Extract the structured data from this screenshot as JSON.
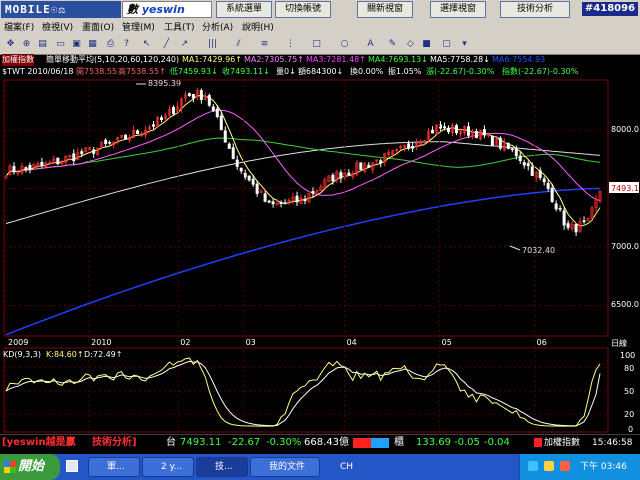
{
  "top": {
    "logo": "MOBILE☉⚖",
    "brand_prefix": "數",
    "brand": "yeswin",
    "buttons": [
      "系統選單",
      "切換帳號",
      "關新視窗",
      "選擇視窗",
      "技術分析"
    ],
    "badge": "#418096"
  },
  "menu": [
    "檔案(F)",
    "檢視(V)",
    "畫面(O)",
    "管理(M)",
    "工具(T)",
    "分析(A)",
    "說明(H)"
  ],
  "title_row": {
    "index_name": "加權指數",
    "ma_label": "簡單移動平均(5,10,20,60,120,240)",
    "ma1": "MA1:7429.96↑",
    "ma2": "MA2:7305.75↑",
    "ma3": "MA3:7281.48↑",
    "ma4": "MA4:7693.13↓",
    "ma5": "MA5:7758.28↓",
    "ma6": "MA6:7554.93"
  },
  "info_row": {
    "symbol_date": "$TWT 2010/06/18",
    "open": "開7538.55",
    "high": "高7538.55↑",
    "low": "低7459.93↓",
    "close": "收7493.11↓",
    "volume": "量0↓",
    "amount": "額684300↓",
    "turnover": "換0.00%",
    "amplitude": "振1.05%",
    "change": "漲(-22.67)-0.30%",
    "pts": "指數(-22.67)-0.30%"
  },
  "price_axis": [
    "8000.0",
    "7500.0",
    "7000.0",
    "6500.0"
  ],
  "price_current": "7493.1",
  "price_unit": "日線",
  "annot_high": "8395.39",
  "annot_low": "7032.40",
  "time_labels": [
    "2009",
    "2010",
    "02",
    "03",
    "04",
    "05",
    "06"
  ],
  "kd": {
    "label": "KD(9,3,3)",
    "k": "K:84.60↑",
    "d": "D:72.49↑",
    "axis": [
      "100",
      "80",
      "50",
      "20",
      "0"
    ]
  },
  "status": {
    "brand": "[yeswin越是贏",
    "section": "技術分析]",
    "market": "台",
    "index": "7493.11",
    "change": "-22.67",
    "pct": "-0.30%",
    "amount": "668.43億",
    "otc": "櫃",
    "otc_index": "133.69",
    "otc_change": "-0.05",
    "otc_pct": "-0.04",
    "index_name": "加權指數",
    "time": "15:46:58"
  },
  "taskbar": {
    "start": "開始",
    "tasks": [
      "軍...",
      "2 y...",
      "技...",
      "我的文件"
    ],
    "lang": "CH",
    "clock": "下午 03:46"
  },
  "colors": {
    "up": "#ff3030",
    "down": "#ffffff",
    "ma1": "#ffff80",
    "ma2": "#ff80ff",
    "ma3": "#40ff40",
    "ma4": "#2040ff",
    "ma5": "#ffffff",
    "k": "#ffff80",
    "d": "#ffffff",
    "accent": "#00ffff"
  }
}
